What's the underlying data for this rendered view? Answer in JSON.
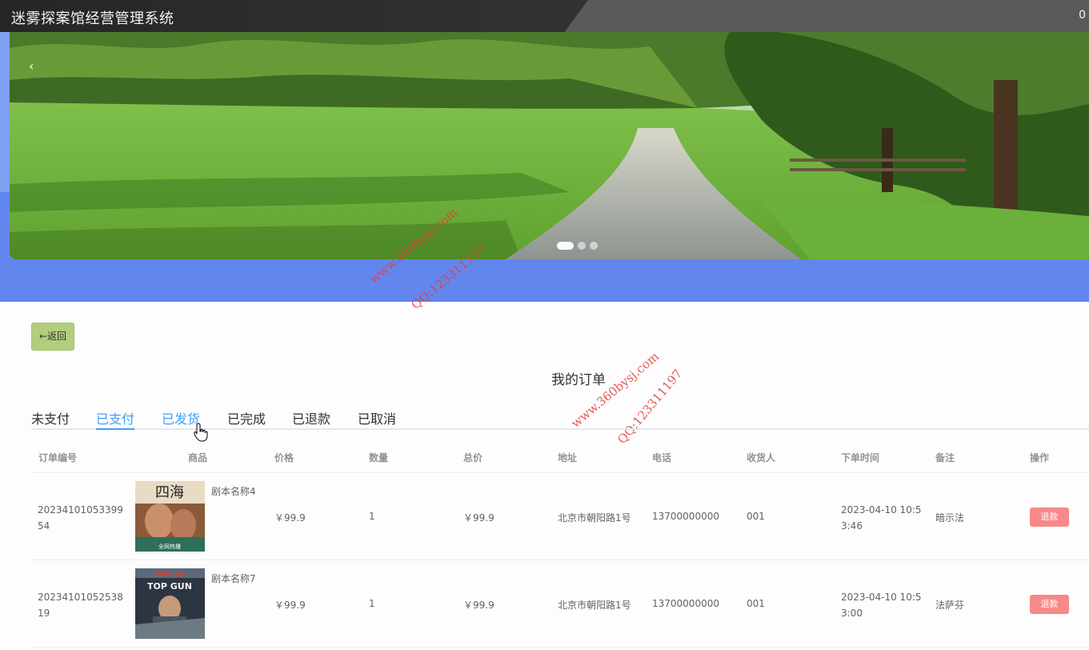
{
  "header": {
    "title": "迷雾探案馆经营管理系统",
    "right_text": "0"
  },
  "banner": {
    "prev_label": "‹",
    "dots": 3,
    "active_dot": 0
  },
  "watermarks": [
    "www.360bysj.com",
    "QQ:123311197"
  ],
  "back_button": "←返回",
  "page_heading": "我的订单",
  "tabs": [
    "未支付",
    "已支付",
    "已发货",
    "已完成",
    "已退款",
    "已取消"
  ],
  "active_tab": "已支付",
  "table": {
    "headers": [
      "订单编号",
      "商品",
      "价格",
      "数量",
      "总价",
      "地址",
      "电话",
      "收货人",
      "下单时间",
      "备注",
      "操作"
    ],
    "rows": [
      {
        "order_no_line1": "20234101053399",
        "order_no_line2": "54",
        "product_name": "剧本名称4",
        "poster_text": "四海",
        "poster_sub": "全网热播",
        "price": "￥99.9",
        "quantity": "1",
        "total": "￥99.9",
        "address": "北京市朝阳路1号",
        "phone": "13700000000",
        "receiver": "001",
        "time_line1": "2023-04-10 10:5",
        "time_line2": "3:46",
        "remark": "暗示法",
        "action": "退款"
      },
      {
        "order_no_line1": "20234101052538",
        "order_no_line2": "19",
        "product_name": "剧本名称7",
        "poster_text": "TOP GUN",
        "poster_sub": "IMAX 3D",
        "price": "￥99.9",
        "quantity": "1",
        "total": "￥99.9",
        "address": "北京市朝阳路1号",
        "phone": "13700000000",
        "receiver": "001",
        "time_line1": "2023-04-10 10:5",
        "time_line2": "3:00",
        "remark": "法萨芬",
        "action": "退款"
      }
    ]
  },
  "colors": {
    "accent": "#409eff",
    "banner_bg": "#6286ee",
    "back_button": "#b2cd7e",
    "refund_button": "#f78989"
  }
}
